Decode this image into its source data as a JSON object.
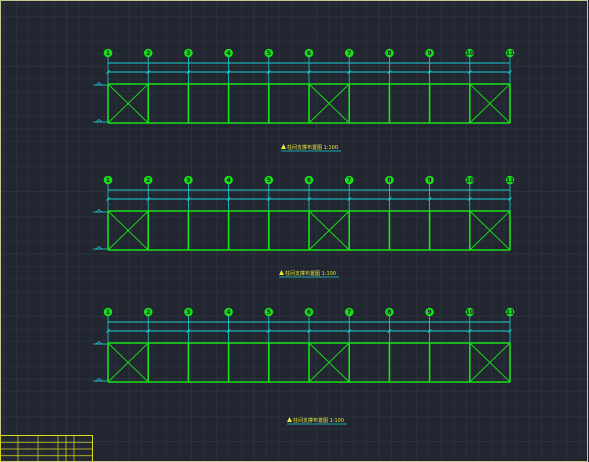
{
  "viewport": {
    "background": "#212630",
    "grid_color": "#2f3542",
    "major_grid_color": "#353c4a",
    "sheet_border_color": "#c8c890"
  },
  "colors": {
    "frame": "#19e019",
    "dim": "#19d0d0",
    "bubble": "#19e019",
    "caption": "#e8e840",
    "caption_underline": "#19d0d0",
    "title_block": "#d8d820"
  },
  "axis_labels": [
    "1",
    "2",
    "3",
    "4",
    "5",
    "6",
    "7",
    "8",
    "9",
    "10",
    "11"
  ],
  "elevations": [
    {
      "id": "A",
      "caption": "柱间支撑布置图 1:100",
      "braced_bays": [
        0,
        5,
        9
      ]
    },
    {
      "id": "B",
      "caption": "柱间支撑布置图 1:100",
      "braced_bays": [
        0,
        5,
        9
      ]
    },
    {
      "id": "C",
      "caption": "柱间支撑布置图 1:100",
      "braced_bays": [
        0,
        5,
        9
      ]
    }
  ],
  "title_block": {
    "rows": 4,
    "cols": 6
  }
}
